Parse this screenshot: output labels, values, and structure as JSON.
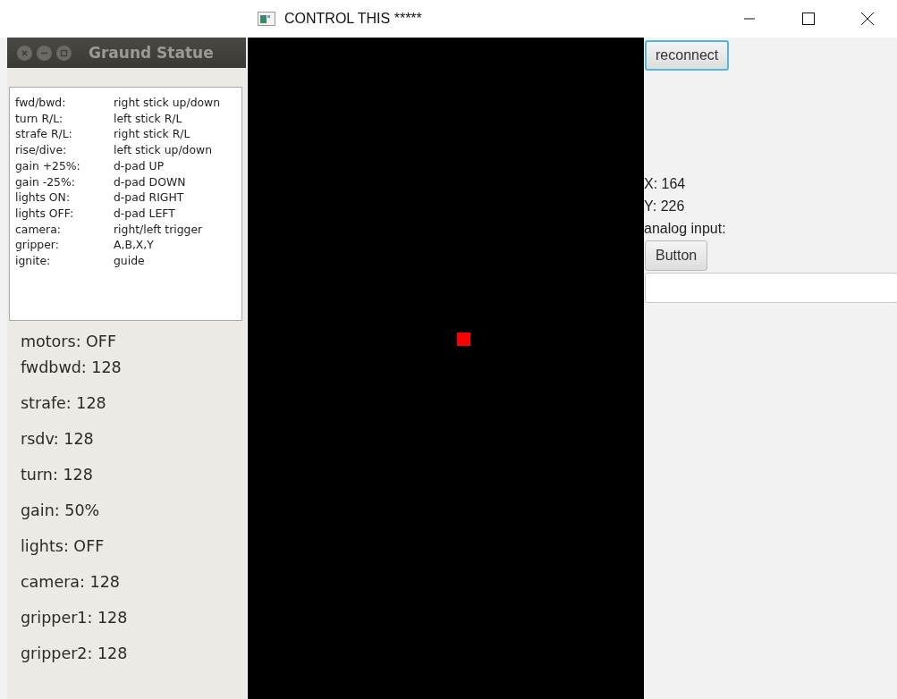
{
  "main_window": {
    "title": "CONTROL THIS *****"
  },
  "status_window": {
    "title": "Graund Statue",
    "mappings": [
      {
        "action": "fwd/bwd:",
        "control": "right stick up/down"
      },
      {
        "action": "turn R/L:",
        "control": "left stick R/L"
      },
      {
        "action": "strafe R/L:",
        "control": "right stick R/L"
      },
      {
        "action": "rise/dive:",
        "control": "left stick up/down"
      },
      {
        "action": "gain +25%:",
        "control": "d-pad UP"
      },
      {
        "action": "gain -25%:",
        "control": "d-pad DOWN"
      },
      {
        "action": "lights ON:",
        "control": "d-pad RIGHT"
      },
      {
        "action": "lights OFF:",
        "control": "d-pad LEFT"
      },
      {
        "action": "camera:",
        "control": "right/left trigger"
      },
      {
        "action": "gripper:",
        "control": "A,B,X,Y"
      },
      {
        "action": "ignite:",
        "control": "guide"
      }
    ],
    "status": [
      "motors: OFF",
      "fwdbwd: 128",
      "strafe: 128",
      "rsdv: 128",
      "turn: 128",
      "gain: 50%",
      "lights: OFF",
      "camera: 128",
      "gripper1: 128",
      "gripper2: 128"
    ]
  },
  "side_panel": {
    "reconnect_button": {
      "label": "reconnect",
      "focused": true
    },
    "x_reading": "X: 164",
    "y_reading": "Y: 226",
    "analog_label": "analog input:",
    "button": "Button"
  }
}
